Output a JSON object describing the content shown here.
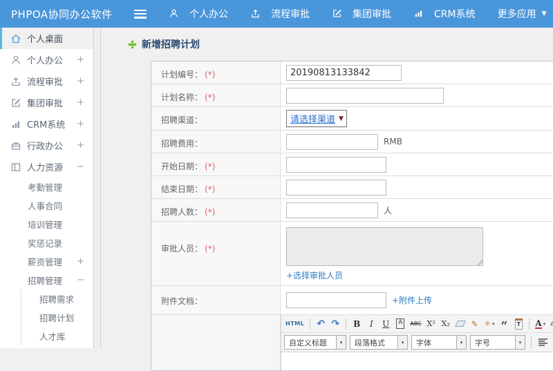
{
  "topbar": {
    "logo": "PHPOA协同办公软件",
    "caret": "▼",
    "nav": [
      {
        "label": "个人办公"
      },
      {
        "label": "流程审批"
      },
      {
        "label": "集团审批"
      },
      {
        "label": "CRM系统"
      },
      {
        "label": "更多应用"
      }
    ]
  },
  "sidebar": {
    "items": [
      {
        "label": "个人桌面"
      },
      {
        "label": "个人办公",
        "toggle": "+"
      },
      {
        "label": "流程审批",
        "toggle": "+"
      },
      {
        "label": "集团审批",
        "toggle": "+"
      },
      {
        "label": "CRM系统",
        "toggle": "+"
      },
      {
        "label": "行政办公",
        "toggle": "+"
      },
      {
        "label": "人力资源",
        "toggle": "−"
      },
      {
        "label": "考勤管理"
      },
      {
        "label": "人事合同"
      },
      {
        "label": "培训管理"
      },
      {
        "label": "奖惩记录"
      },
      {
        "label": "薪资管理",
        "toggle": "+"
      },
      {
        "label": "招聘管理",
        "toggle": "−"
      },
      {
        "label": "招聘需求"
      },
      {
        "label": "招聘计划"
      },
      {
        "label": "人才库"
      }
    ]
  },
  "main": {
    "page_title": "新增招聘计划",
    "form": {
      "required_mark": "(*)",
      "rows": [
        {
          "label": "计划编号：",
          "value": "20190813133842"
        },
        {
          "label": "计划名称：",
          "value": ""
        },
        {
          "label": "招聘渠道：",
          "select_value": "请选择渠道"
        },
        {
          "label": "招聘费用：",
          "suffix": "RMB"
        },
        {
          "label": "开始日期："
        },
        {
          "label": "结束日期："
        },
        {
          "label": "招聘人数：",
          "suffix": "人"
        },
        {
          "label": "审批人员：",
          "link": "+选择审批人员"
        },
        {
          "label": "附件文档：",
          "link": "+附件上传"
        }
      ]
    },
    "editor": {
      "html_button": "HTML",
      "undo_glyph": "↶",
      "redo_glyph": "↷",
      "bold": "B",
      "italic": "I",
      "underline": "U",
      "font_box": "A",
      "strike": "ABC",
      "superscript": "X²",
      "subscript": "X₂",
      "quote": "“",
      "sparkle": "✳",
      "brush": "✎",
      "paste_letter": "T",
      "font_color": "A",
      "highlight": "ab",
      "caret": "▾",
      "combos": [
        "自定义标题",
        "段落格式",
        "字体",
        "字号"
      ]
    }
  },
  "colors": {
    "topbar_blue": "#4a96db",
    "title_navy": "#2a4a70",
    "link_blue": "#2e7bc4",
    "required_red": "#e05c5c",
    "plus_green": "#6abe30",
    "active_border": "#57b7e2"
  }
}
